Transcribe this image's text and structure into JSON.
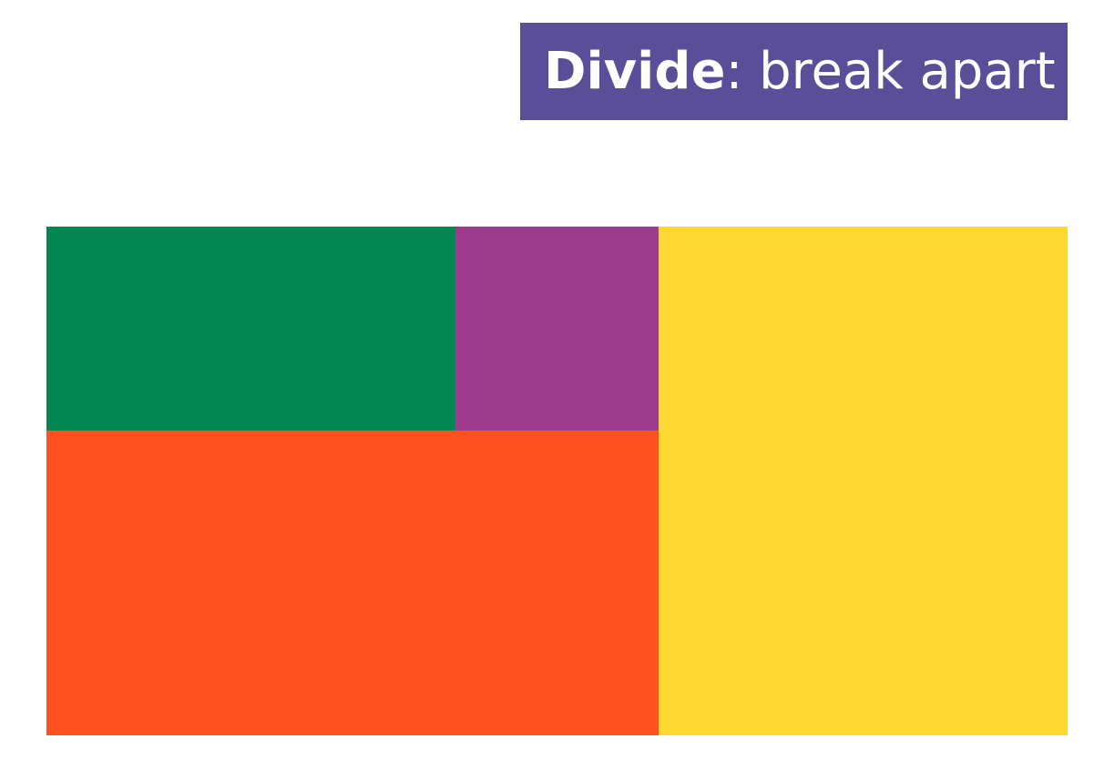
{
  "title": {
    "keyword": "Divide",
    "separator": ":",
    "rest": " break apart",
    "background_color": "#5b4e98"
  },
  "blocks": [
    {
      "name": "block-green",
      "color": "#028752"
    },
    {
      "name": "block-purple",
      "color": "#9b3d8c"
    },
    {
      "name": "block-orange",
      "color": "#ff5220"
    },
    {
      "name": "block-yellow",
      "color": "#ffd731"
    }
  ]
}
